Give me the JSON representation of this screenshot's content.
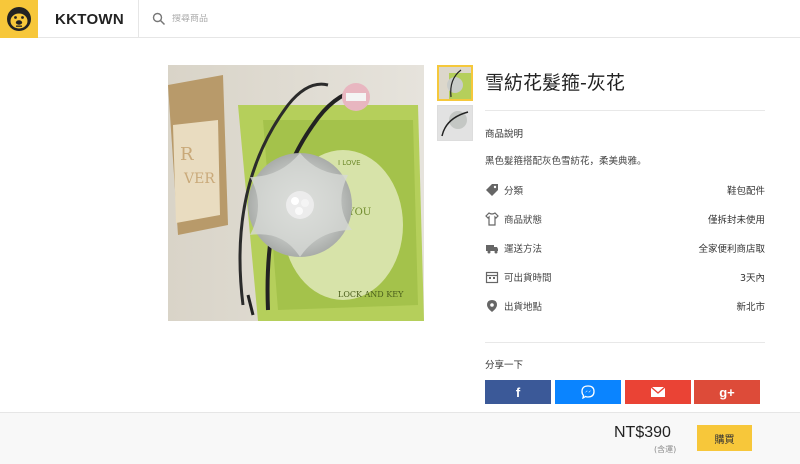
{
  "header": {
    "brand": "KKTOWN",
    "search_placeholder": "搜尋商品"
  },
  "product": {
    "title": "雪紡花髮箍-灰花",
    "description_label": "商品說明",
    "description": "黑色髮箍搭配灰色雪紡花，柔美典雅。",
    "specs": [
      {
        "icon": "tag-icon",
        "label": "分類",
        "value": "鞋包配件"
      },
      {
        "icon": "shirt-icon",
        "label": "商品狀態",
        "value": "僅拆封未使用"
      },
      {
        "icon": "truck-icon",
        "label": "運送方法",
        "value": "全家便利商店取"
      },
      {
        "icon": "calendar-icon",
        "label": "可出貨時間",
        "value": "3天內"
      },
      {
        "icon": "location-pin-icon",
        "label": "出貨地點",
        "value": "新北市"
      }
    ]
  },
  "share": {
    "label": "分享一下",
    "buttons": [
      {
        "name": "facebook",
        "glyph": "f",
        "color": "#3b5998"
      },
      {
        "name": "messenger",
        "glyph": "",
        "color": "#0a84ff"
      },
      {
        "name": "email",
        "glyph": "",
        "color": "#ea4335"
      },
      {
        "name": "google-plus",
        "glyph": "g+",
        "color": "#dd4b39"
      }
    ]
  },
  "footer": {
    "price": "NT$390",
    "price_note": "(含運)",
    "buy_label": "購買"
  },
  "colors": {
    "brand_yellow": "#f7c73a",
    "facebook": "#3b5998",
    "messenger": "#0a84ff",
    "email": "#ea4335",
    "google_plus": "#dd4b39"
  }
}
